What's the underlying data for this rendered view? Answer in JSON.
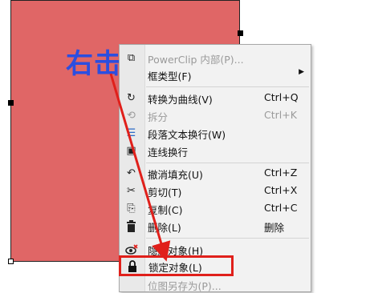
{
  "callout": "右击",
  "menu": {
    "items": [
      {
        "id": "powerclip",
        "label": "PowerClip 内部(P)...",
        "shortcut": "",
        "icon": "powerclip-icon",
        "glyph": "⧉",
        "disabled": true
      },
      {
        "id": "frame-type",
        "label": "框类型(F)",
        "shortcut": "",
        "icon": "",
        "glyph": "",
        "disabled": false,
        "submenu": true
      },
      {
        "id": "convert-curves",
        "label": "转换为曲线(V)",
        "shortcut": "Ctrl+Q",
        "icon": "convert-curve-icon",
        "glyph": "↻",
        "disabled": false
      },
      {
        "id": "break-apart",
        "label": "拆分",
        "shortcut": "Ctrl+K",
        "icon": "break-apart-icon",
        "glyph": "⟲",
        "disabled": true
      },
      {
        "id": "paragraph-wrap",
        "label": "段落文本换行(W)",
        "shortcut": "",
        "icon": "paragraph-wrap-icon",
        "glyph": "☰",
        "disabled": false
      },
      {
        "id": "connector-wrap",
        "label": "连线换行",
        "shortcut": "",
        "icon": "connector-wrap-icon",
        "glyph": "▣",
        "disabled": false
      },
      {
        "id": "undo-fill",
        "label": "撤消填充(U)",
        "shortcut": "Ctrl+Z",
        "icon": "undo-icon",
        "glyph": "↶",
        "disabled": false
      },
      {
        "id": "cut",
        "label": "剪切(T)",
        "shortcut": "Ctrl+X",
        "icon": "cut-icon",
        "glyph": "✂",
        "disabled": false
      },
      {
        "id": "copy",
        "label": "复制(C)",
        "shortcut": "Ctrl+C",
        "icon": "copy-icon",
        "glyph": "⎘",
        "disabled": false
      },
      {
        "id": "delete",
        "label": "删除(L)",
        "shortcut": "删除",
        "icon": "trash-icon",
        "glyph": "🗑",
        "disabled": false
      },
      {
        "id": "hide-object",
        "label": "隐藏对象(H)",
        "shortcut": "",
        "icon": "hide-eye-icon",
        "glyph": "◉",
        "disabled": false
      },
      {
        "id": "lock-object",
        "label": "锁定对象(L)",
        "shortcut": "",
        "icon": "lock-icon",
        "glyph": "🔒",
        "disabled": false
      },
      {
        "id": "save-bitmap",
        "label": "位图另存为(P)...",
        "shortcut": "",
        "icon": "",
        "glyph": "",
        "disabled": true
      }
    ]
  },
  "colors": {
    "shape_fill": "#e06666",
    "callout": "#2b4ee0",
    "highlight": "#e0201b",
    "arrow": "#e0201b"
  }
}
